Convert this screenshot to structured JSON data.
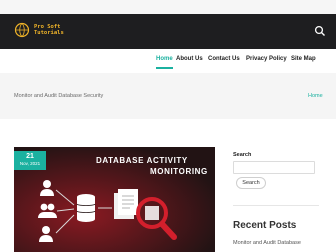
{
  "brand": {
    "logo_line1": "Pro Soft",
    "logo_line2": "Tutorials"
  },
  "nav": {
    "items": [
      {
        "label": "Home",
        "active": true
      },
      {
        "label": "About Us"
      },
      {
        "label": "Contact Us"
      },
      {
        "label": "Privacy Policy"
      },
      {
        "label": "Site Map"
      }
    ]
  },
  "banner": {
    "title": "Monitor and Audit Database Security",
    "crumb": "Home"
  },
  "post": {
    "date_day": "21",
    "date_month": "Nov, 2021",
    "image_text_line1": "DATABASE ACTIVITY",
    "image_text_line2": "MONITORING"
  },
  "sidebar": {
    "search_label": "Search",
    "search_value": "",
    "search_button": "Search",
    "recent_heading": "Recent Posts",
    "recent_first": "Monitor and Audit Database"
  },
  "colors": {
    "accent": "#1bb1a0",
    "topbar": "#1e1e20",
    "logo": "#f0b429",
    "image_bg": "#221314"
  },
  "icons": [
    "globe-logo-icon",
    "search-icon",
    "magnifier-icon",
    "user-icon",
    "database-icon",
    "document-icon"
  ]
}
